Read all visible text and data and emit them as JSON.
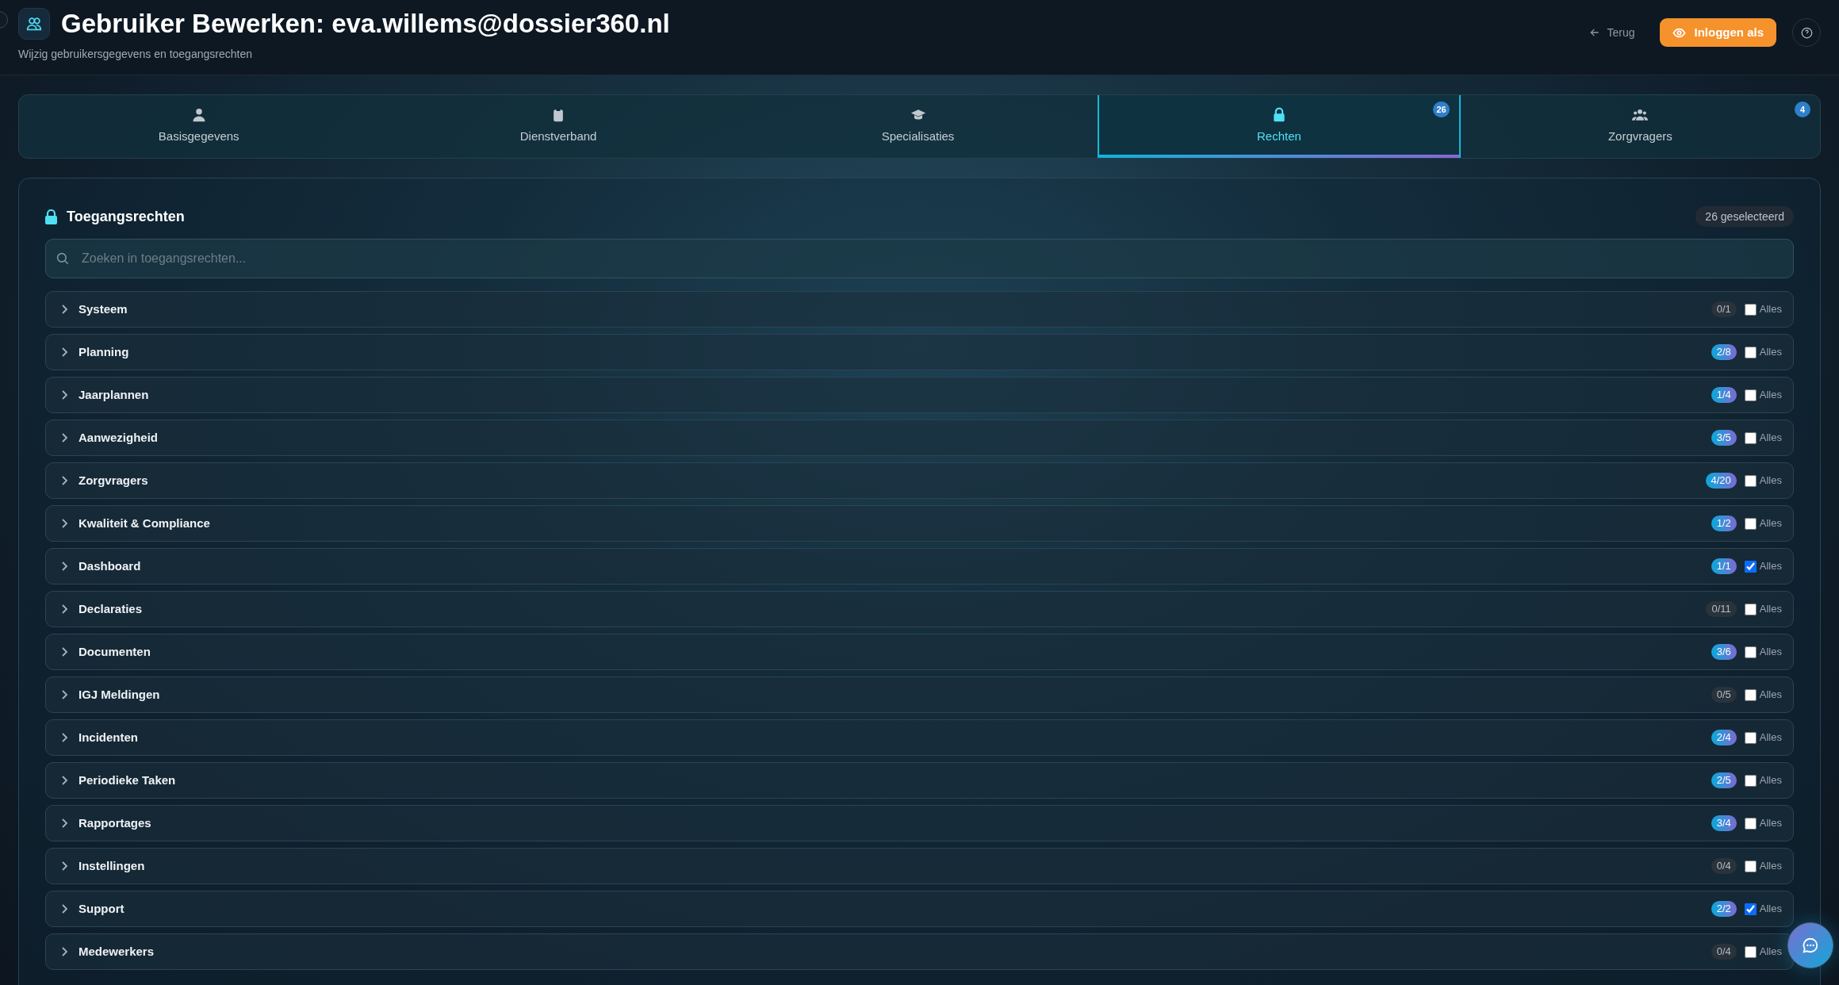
{
  "header": {
    "title": "Gebruiker Bewerken: eva.willems@dossier360.nl",
    "subtitle": "Wijzig gebruikersgegevens en toegangsrechten",
    "back_link": "Terug",
    "login_button": "Inloggen als"
  },
  "tabs": [
    {
      "label": "Basisgegevens",
      "kind": "person",
      "selected": false
    },
    {
      "label": "Dienstverband",
      "kind": "clipboard",
      "selected": false
    },
    {
      "label": "Specialisaties",
      "kind": "cap",
      "selected": false
    },
    {
      "label": "Rechten",
      "kind": "lock",
      "selected": true,
      "badge": "26"
    },
    {
      "label": "Zorgvragers",
      "kind": "people",
      "selected": false,
      "badge": "4"
    }
  ],
  "panel": {
    "title": "Toegangsrechten",
    "selected_count": "26 geselecteerd",
    "search": {
      "placeholder": "Zoeken in toegangsrechten..."
    },
    "groups": [
      {
        "name": "Systeem",
        "count": "0/1",
        "highlighted": false,
        "all_label": "Alles",
        "checked": false
      },
      {
        "name": "Planning",
        "count": "2/8",
        "highlighted": true,
        "all_label": "Alles",
        "checked": false
      },
      {
        "name": "Jaarplannen",
        "count": "1/4",
        "highlighted": true,
        "all_label": "Alles",
        "checked": false
      },
      {
        "name": "Aanwezigheid",
        "count": "3/5",
        "highlighted": true,
        "all_label": "Alles",
        "checked": false
      },
      {
        "name": "Zorgvragers",
        "count": "4/20",
        "highlighted": true,
        "all_label": "Alles",
        "checked": false
      },
      {
        "name": "Kwaliteit & Compliance",
        "count": "1/2",
        "highlighted": true,
        "all_label": "Alles",
        "checked": false
      },
      {
        "name": "Dashboard",
        "count": "1/1",
        "highlighted": true,
        "all_label": "Alles",
        "checked": true
      },
      {
        "name": "Declaraties",
        "count": "0/11",
        "highlighted": false,
        "all_label": "Alles",
        "checked": false
      },
      {
        "name": "Documenten",
        "count": "3/6",
        "highlighted": true,
        "all_label": "Alles",
        "checked": false
      },
      {
        "name": "IGJ Meldingen",
        "count": "0/5",
        "highlighted": false,
        "all_label": "Alles",
        "checked": false
      },
      {
        "name": "Incidenten",
        "count": "2/4",
        "highlighted": true,
        "all_label": "Alles",
        "checked": false
      },
      {
        "name": "Periodieke Taken",
        "count": "2/5",
        "highlighted": true,
        "all_label": "Alles",
        "checked": false
      },
      {
        "name": "Rapportages",
        "count": "3/4",
        "highlighted": true,
        "all_label": "Alles",
        "checked": false
      },
      {
        "name": "Instellingen",
        "count": "0/4",
        "highlighted": false,
        "all_label": "Alles",
        "checked": false
      },
      {
        "name": "Support",
        "count": "2/2",
        "highlighted": true,
        "all_label": "Alles",
        "checked": true
      },
      {
        "name": "Medewerkers",
        "count": "0/4",
        "highlighted": false,
        "all_label": "Alles",
        "checked": false
      }
    ]
  }
}
